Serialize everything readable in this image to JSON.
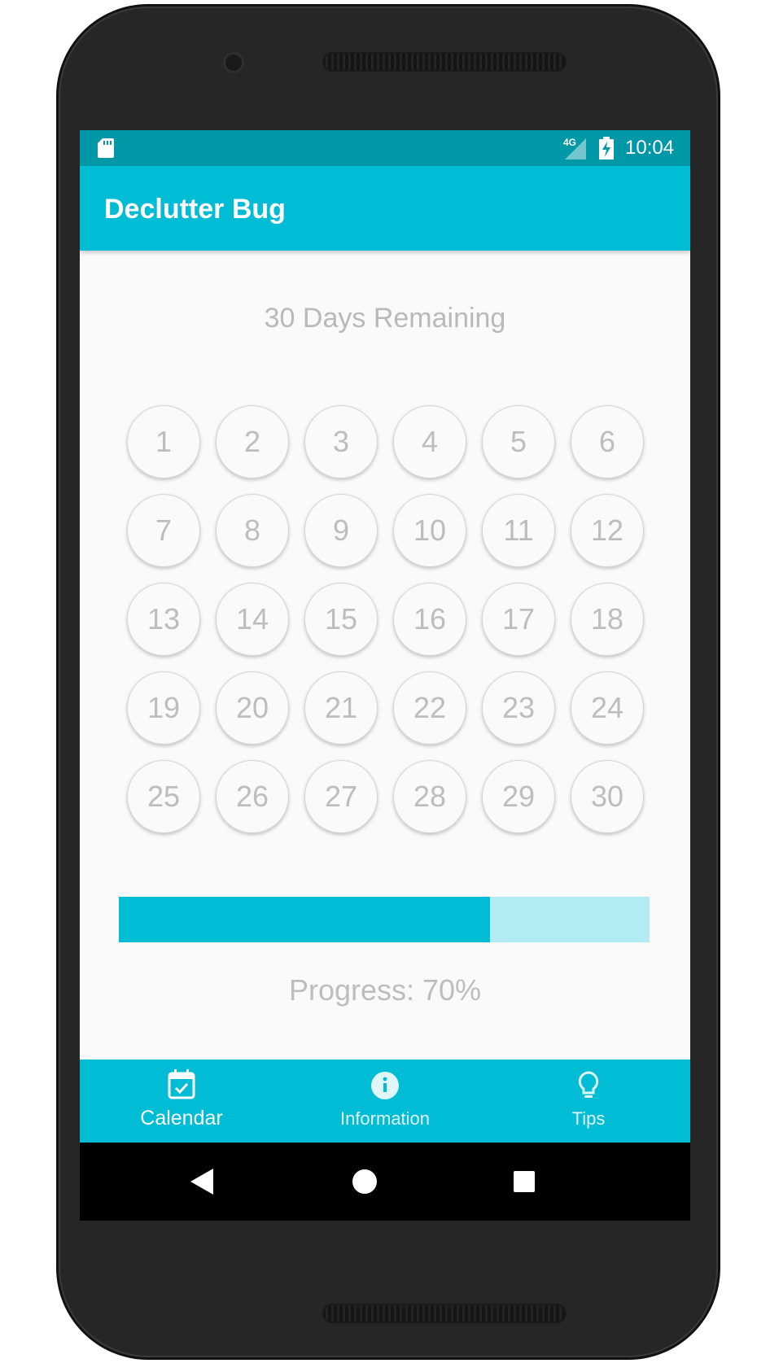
{
  "status_bar": {
    "network": "4G",
    "time": "10:04"
  },
  "app_bar": {
    "title": "Declutter Bug"
  },
  "main": {
    "days_remaining_text": "30 Days Remaining",
    "days": [
      "1",
      "2",
      "3",
      "4",
      "5",
      "6",
      "7",
      "8",
      "9",
      "10",
      "11",
      "12",
      "13",
      "14",
      "15",
      "16",
      "17",
      "18",
      "19",
      "20",
      "21",
      "22",
      "23",
      "24",
      "25",
      "26",
      "27",
      "28",
      "29",
      "30"
    ],
    "progress_fraction": 0.7,
    "progress_text": "Progress: 70%"
  },
  "bottom_nav": {
    "items": [
      {
        "label": "Calendar",
        "icon": "calendar-check-icon",
        "active": true
      },
      {
        "label": "Information",
        "icon": "info-icon",
        "active": false
      },
      {
        "label": "Tips",
        "icon": "lightbulb-icon",
        "active": false
      }
    ]
  },
  "system_nav": {
    "buttons": [
      "back-icon",
      "home-icon",
      "recents-icon"
    ]
  },
  "colors": {
    "primary": "#00bcd4",
    "primary_dark": "#0097a7",
    "progress_track": "#b2ebf2",
    "muted_text": "#bdbdbd"
  }
}
